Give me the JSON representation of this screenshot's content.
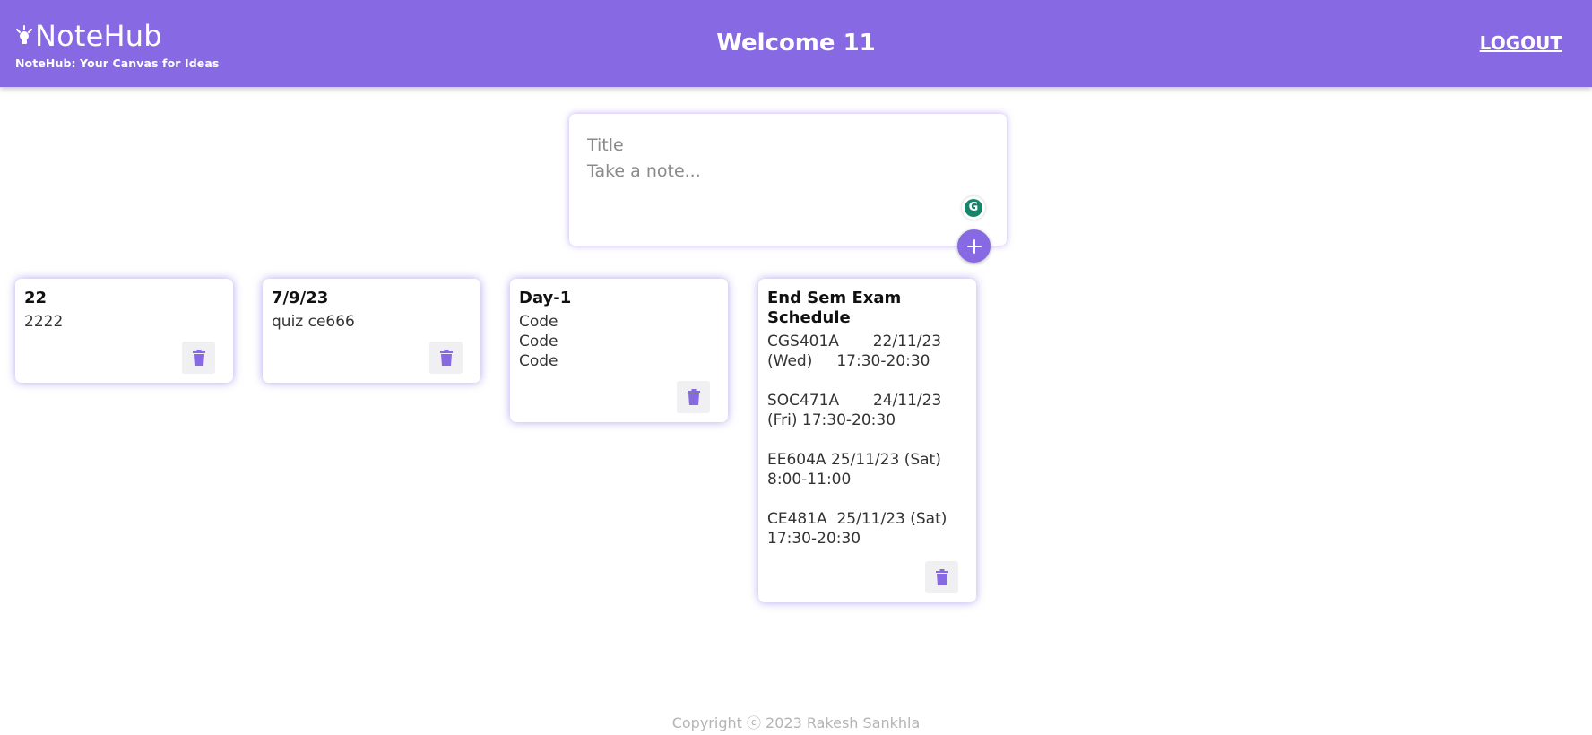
{
  "header": {
    "brand_title": "NoteHub",
    "brand_tagline": "NoteHub: Your Canvas for Ideas",
    "brand_icon": "lightbulb-icon",
    "welcome": "Welcome 11",
    "logout_label": "LOGOUT"
  },
  "create_note": {
    "title_placeholder": "Title",
    "content_placeholder": "Take a note...",
    "add_icon": "plus-icon",
    "grammarly_icon": "grammarly-icon"
  },
  "notes": [
    {
      "title": "22",
      "content": "2222",
      "delete_icon": "trash-icon"
    },
    {
      "title": "7/9/23",
      "content": "quiz ce666",
      "delete_icon": "trash-icon"
    },
    {
      "title": "Day-1",
      "content": "Code\nCode\nCode",
      "delete_icon": "trash-icon"
    },
    {
      "title": "End Sem Exam Schedule",
      "content": "CGS401A       22/11/23 (Wed)     17:30-20:30\n\nSOC471A       24/11/23 (Fri) 17:30-20:30\n\nEE604A 25/11/23 (Sat) 8:00-11:00\n\nCE481A  25/11/23 (Sat) 17:30-20:30",
      "delete_icon": "trash-icon"
    }
  ],
  "footer": {
    "copyright": "Copyright ⓒ 2023 Rakesh Sankhla"
  },
  "colors": {
    "accent": "#8769e3",
    "header_text": "#ffffff",
    "footer_text": "#b4b4b4"
  }
}
